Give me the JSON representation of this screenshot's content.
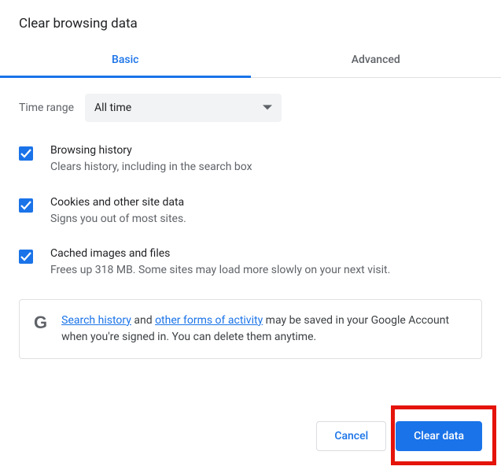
{
  "title": "Clear browsing data",
  "tabs": {
    "basic": "Basic",
    "advanced": "Advanced"
  },
  "time_range": {
    "label": "Time range",
    "value": "All time"
  },
  "options": {
    "history": {
      "title": "Browsing history",
      "desc": "Clears history, including in the search box"
    },
    "cookies": {
      "title": "Cookies and other site data",
      "desc": "Signs you out of most sites."
    },
    "cache": {
      "title": "Cached images and files",
      "desc": "Frees up 318 MB. Some sites may load more slowly on your next visit."
    }
  },
  "notice": {
    "link1": "Search history",
    "middle1": " and ",
    "link2": "other forms of activity",
    "rest": " may be saved in your Google Account when you're signed in. You can delete them anytime."
  },
  "buttons": {
    "cancel": "Cancel",
    "clear": "Clear data"
  },
  "icons": {
    "g_logo": "G"
  }
}
